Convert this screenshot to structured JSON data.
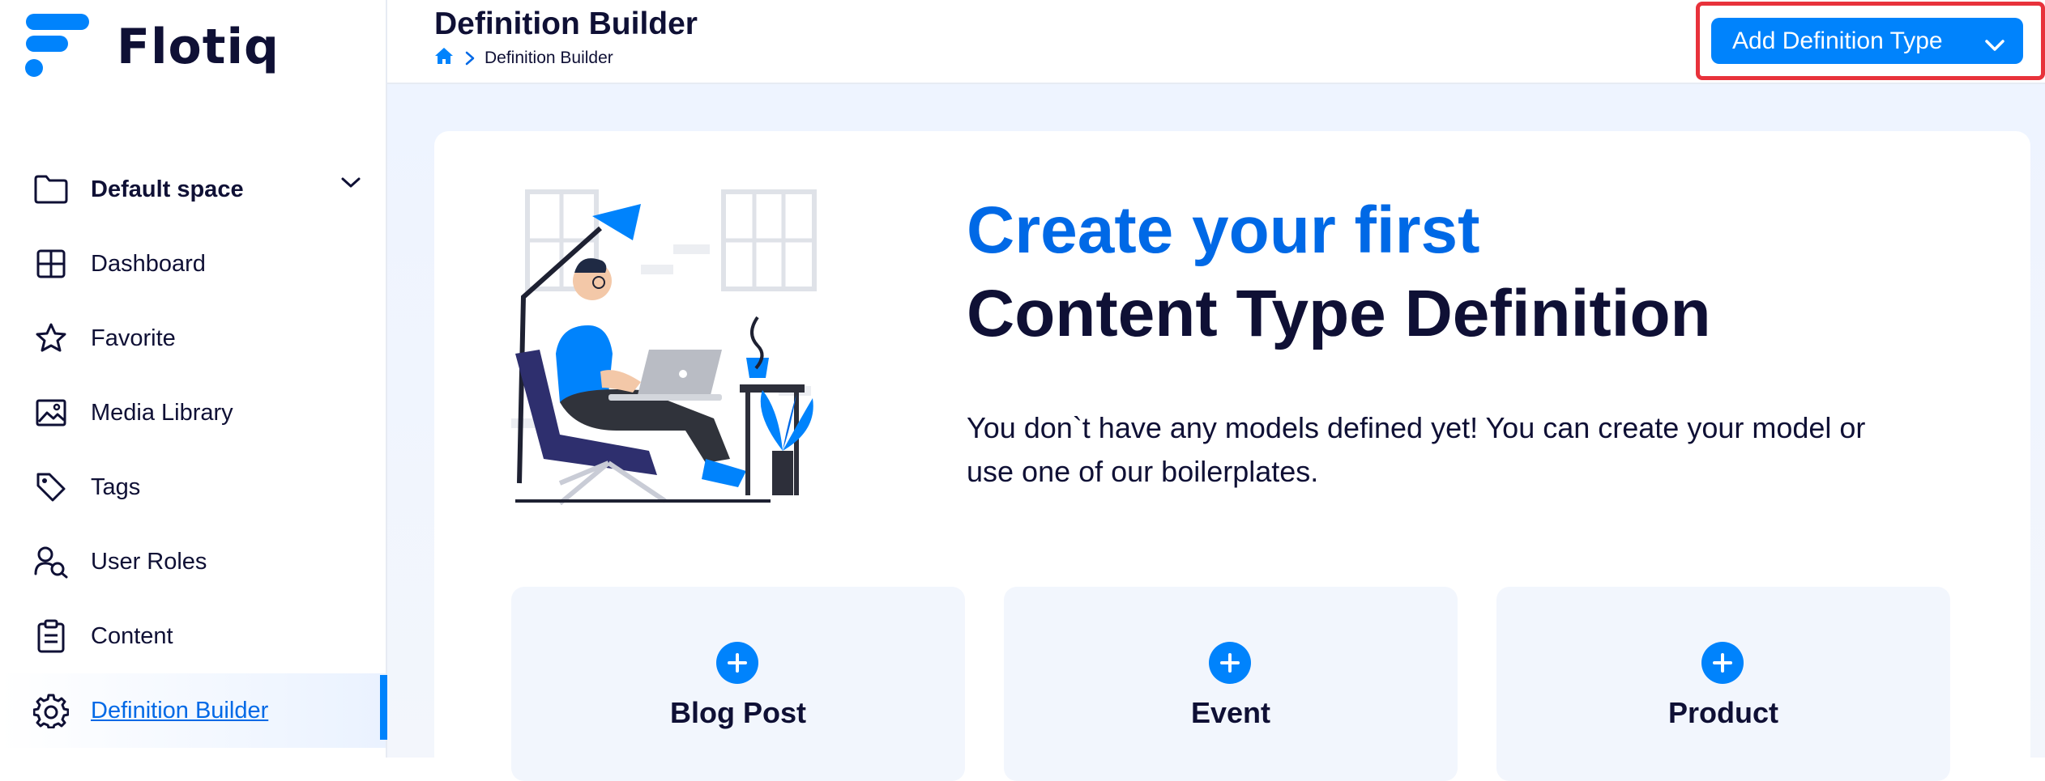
{
  "app": {
    "name": "Flotiq",
    "colors": {
      "brand": "#0083fc",
      "brand_dark": "#0069e6",
      "navy": "#0f1035",
      "highlight": "#e8323b"
    }
  },
  "sidebar": {
    "space": {
      "label": "Default space",
      "icon": "folder-icon"
    },
    "items": [
      {
        "label": "Dashboard",
        "icon": "dashboard-icon",
        "active": false
      },
      {
        "label": "Favorite",
        "icon": "star-icon",
        "active": false
      },
      {
        "label": "Media Library",
        "icon": "image-icon",
        "active": false
      },
      {
        "label": "Tags",
        "icon": "tag-icon",
        "active": false
      },
      {
        "label": "User Roles",
        "icon": "user-roles-icon",
        "active": false
      },
      {
        "label": "Content",
        "icon": "clipboard-icon",
        "active": false
      },
      {
        "label": "Definition Builder",
        "icon": "gear-icon",
        "active": true
      }
    ]
  },
  "header": {
    "title": "Definition Builder",
    "breadcrumb": {
      "home_icon": "home-icon",
      "current": "Definition Builder"
    },
    "add_button": {
      "label": "Add Definition Type",
      "icon": "chevron-down-icon"
    }
  },
  "empty_state": {
    "headline_accent": "Create your first",
    "headline": "Content Type Definition",
    "description": "You don`t have any models defined yet! You can create your model or use one of our boilerplates."
  },
  "templates": [
    {
      "label": "Blog Post",
      "icon": "plus-icon"
    },
    {
      "label": "Event",
      "icon": "plus-icon"
    },
    {
      "label": "Product",
      "icon": "plus-icon"
    }
  ]
}
